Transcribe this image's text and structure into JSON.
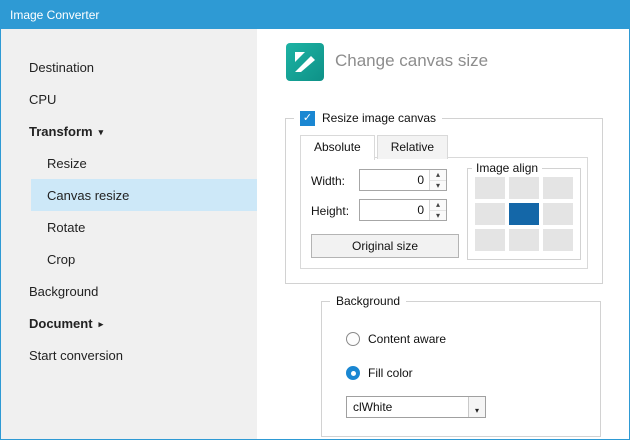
{
  "window": {
    "title": "Image Converter"
  },
  "colors": {
    "titlebar": "#2e9ad4",
    "accent": "#1a87d2",
    "logo_teal": "#14a195",
    "sidebar_selection": "#cde8f8",
    "align_selected": "#1467a8"
  },
  "sidebar": {
    "items": [
      {
        "label": "Destination"
      },
      {
        "label": "CPU"
      },
      {
        "label": "Transform",
        "arrow": "▾"
      },
      {
        "label": "Resize"
      },
      {
        "label": "Canvas resize"
      },
      {
        "label": "Rotate"
      },
      {
        "label": "Crop"
      },
      {
        "label": "Background"
      },
      {
        "label": "Document",
        "arrow": "▸"
      },
      {
        "label": "Start conversion"
      }
    ]
  },
  "main": {
    "header": {
      "title": "Change canvas size"
    },
    "resize_group": {
      "title": "Resize image canvas",
      "checkbox_checked": true,
      "tabs": [
        "Absolute",
        "Relative"
      ],
      "width": {
        "label": "Width:",
        "value": "0"
      },
      "height": {
        "label": "Height:",
        "value": "0"
      },
      "original_size_button": "Original size",
      "image_align": {
        "title": "Image align",
        "selected_cell": "center"
      }
    },
    "background_group": {
      "title": "Background",
      "options": [
        {
          "label": "Content aware",
          "selected": false
        },
        {
          "label": "Fill color",
          "selected": true
        }
      ],
      "fill_color_value": "clWhite"
    }
  }
}
